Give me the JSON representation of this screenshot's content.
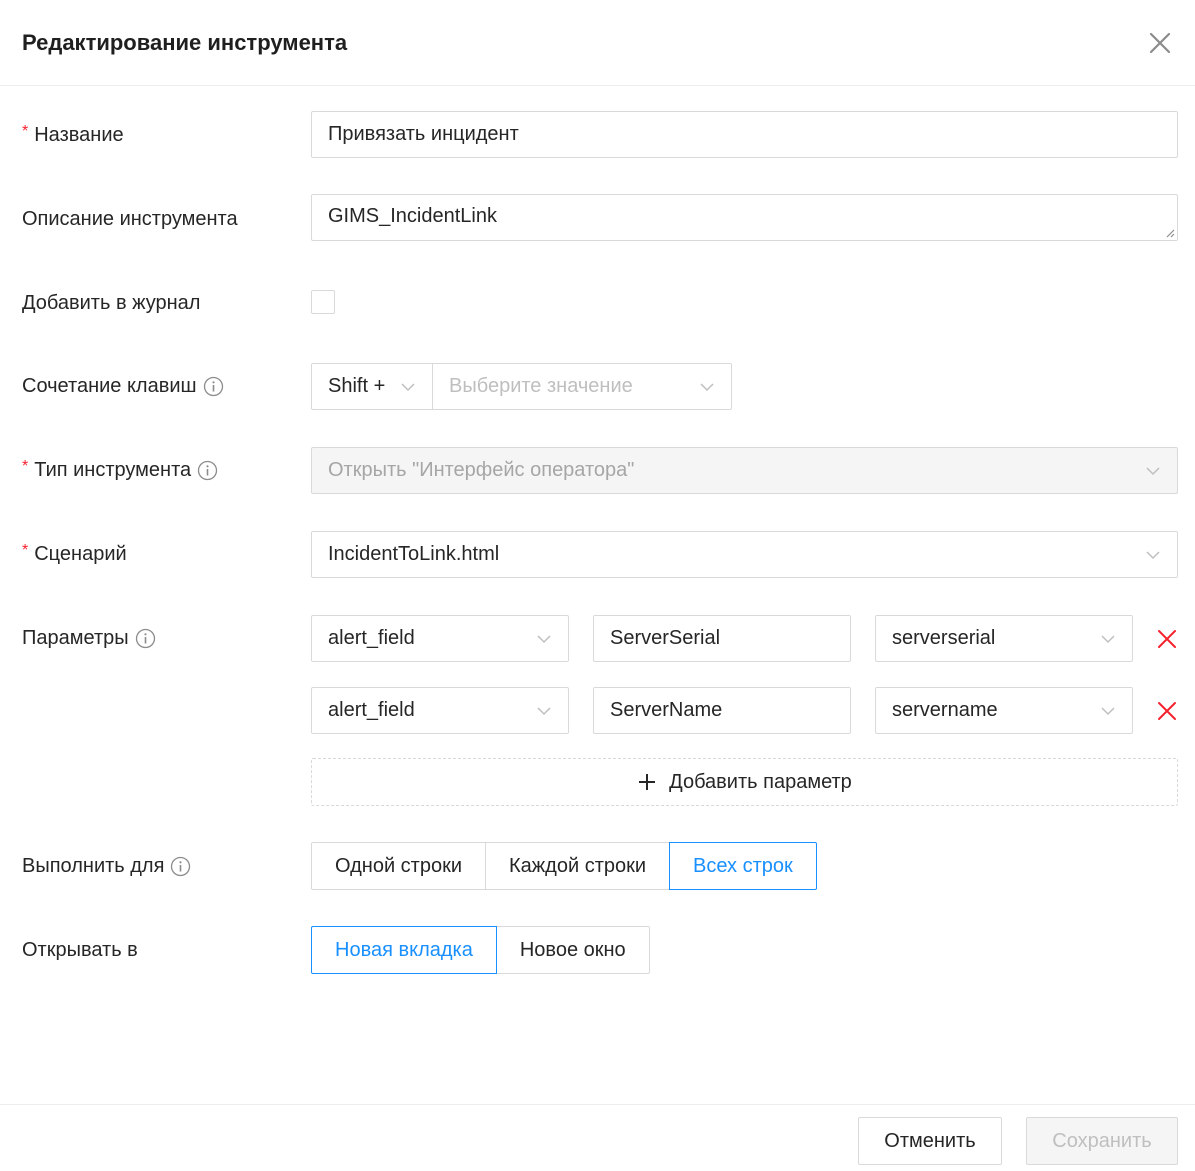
{
  "dialog": {
    "title": "Редактирование инструмента"
  },
  "form": {
    "name": {
      "label": "Название",
      "value": "Привязать инцидент"
    },
    "description": {
      "label": "Описание инструмента",
      "value": "GIMS_IncidentLink"
    },
    "add_to_journal": {
      "label": "Добавить в журнал",
      "checked": false
    },
    "hotkey": {
      "label": "Сочетание клавиш",
      "modifier": "Shift +",
      "key_placeholder": "Выберите значение"
    },
    "tool_type": {
      "label": "Тип инструмента",
      "value": "Открыть \"Интерфейс оператора\""
    },
    "scenario": {
      "label": "Сценарий",
      "value": "IncidentToLink.html"
    },
    "parameters": {
      "label": "Параметры",
      "rows": [
        {
          "source": "alert_field",
          "name": "ServerSerial",
          "field": "serverserial"
        },
        {
          "source": "alert_field",
          "name": "ServerName",
          "field": "servername"
        }
      ],
      "add_label": "Добавить параметр"
    },
    "execute_for": {
      "label": "Выполнить для",
      "options": [
        "Одной строки",
        "Каждой строки",
        "Всех строк"
      ],
      "selected": "Всех строк"
    },
    "open_in": {
      "label": "Открывать в",
      "options": [
        "Новая вкладка",
        "Новое окно"
      ],
      "selected": "Новая вкладка"
    }
  },
  "footer": {
    "cancel_label": "Отменить",
    "save_label": "Сохранить"
  },
  "colors": {
    "accent": "#1890ff",
    "required": "#f5222d",
    "delete": "#f5222d",
    "border": "#d9d9d9"
  }
}
